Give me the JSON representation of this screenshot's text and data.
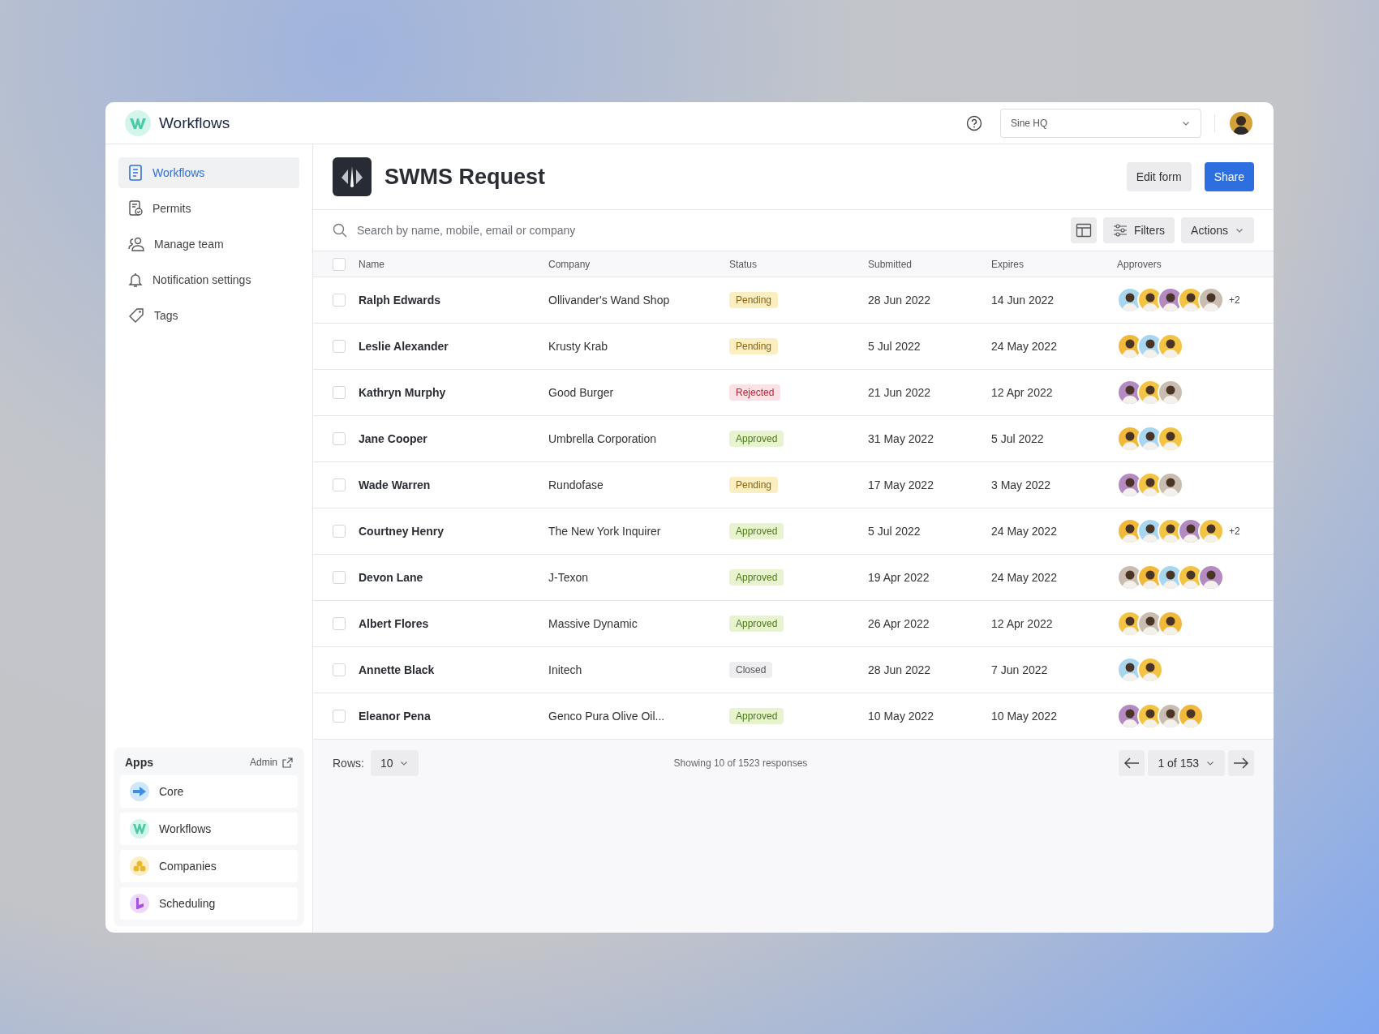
{
  "app": {
    "name": "Workflows"
  },
  "topbar": {
    "workspace": "Sine HQ"
  },
  "sidebar": {
    "items": [
      {
        "label": "Workflows",
        "selected": true
      },
      {
        "label": "Permits",
        "selected": false
      },
      {
        "label": "Manage team",
        "selected": false
      },
      {
        "label": "Notification settings",
        "selected": false
      },
      {
        "label": "Tags",
        "selected": false
      }
    ],
    "apps": {
      "title": "Apps",
      "admin": "Admin",
      "items": [
        {
          "label": "Core",
          "color": "#cfe6fb"
        },
        {
          "label": "Workflows",
          "color": "#d3f5ec"
        },
        {
          "label": "Companies",
          "color": "#fcefc7"
        },
        {
          "label": "Scheduling",
          "color": "#eed9fb"
        }
      ]
    }
  },
  "header": {
    "title": "SWMS Request",
    "buttons": [
      {
        "label": "Edit form",
        "kind": "secondary"
      },
      {
        "label": "Share",
        "kind": "primary"
      }
    ]
  },
  "toolbar": {
    "search_placeholder": "Search by name, mobile, email or company",
    "filters": "Filters",
    "actions": "Actions"
  },
  "table": {
    "select_all_checked": false,
    "columns": [
      "Name",
      "Company",
      "Status",
      "Submitted",
      "Expires",
      "Approvers"
    ],
    "rows": [
      {
        "name": "Ralph Edwards",
        "company": "Ollivander's Wand Shop",
        "status": {
          "label": "Pending",
          "kind": "pending"
        },
        "submitted": "28 Jun 2022",
        "expires": "14 Jun 2022",
        "approvers": [
          {
            "color": "#a9d6ef"
          },
          {
            "color": "#f3c443"
          },
          {
            "color": "#b48ac2"
          },
          {
            "color": "#f3c443"
          },
          {
            "color": "#c9bdb2"
          }
        ],
        "more": "+2",
        "checked": false
      },
      {
        "name": "Leslie Alexander",
        "company": "Krusty Krab",
        "status": {
          "label": "Pending",
          "kind": "pending"
        },
        "submitted": "5 Jul 2022",
        "expires": "24 May 2022",
        "approvers": [
          {
            "color": "#f0b93a"
          },
          {
            "color": "#a9d6ef"
          },
          {
            "color": "#f3c443"
          }
        ],
        "checked": false
      },
      {
        "name": "Kathryn Murphy",
        "company": "Good Burger",
        "status": {
          "label": "Rejected",
          "kind": "rejected"
        },
        "submitted": "21 Jun 2022",
        "expires": "12 Apr 2022",
        "approvers": [
          {
            "color": "#b48ac2"
          },
          {
            "color": "#f3c443"
          },
          {
            "color": "#c9bdb2"
          }
        ],
        "checked": false
      },
      {
        "name": "Jane Cooper",
        "company": "Umbrella Corporation",
        "status": {
          "label": "Approved",
          "kind": "approved"
        },
        "submitted": "31 May 2022",
        "expires": "5 Jul 2022",
        "approvers": [
          {
            "color": "#f0b93a"
          },
          {
            "color": "#a9d6ef"
          },
          {
            "color": "#f3c443"
          }
        ],
        "checked": false
      },
      {
        "name": "Wade Warren",
        "company": "Rundofase",
        "status": {
          "label": "Pending",
          "kind": "pending"
        },
        "submitted": "17 May 2022",
        "expires": "3 May 2022",
        "approvers": [
          {
            "color": "#b48ac2"
          },
          {
            "color": "#f3c443"
          },
          {
            "color": "#c9bdb2"
          }
        ],
        "checked": false
      },
      {
        "name": "Courtney Henry",
        "company": "The New York Inquirer",
        "status": {
          "label": "Approved",
          "kind": "approved"
        },
        "submitted": "5 Jul 2022",
        "expires": "24 May 2022",
        "approvers": [
          {
            "color": "#f0b93a"
          },
          {
            "color": "#a9d6ef"
          },
          {
            "color": "#f3c443"
          },
          {
            "color": "#b48ac2"
          },
          {
            "color": "#f3c443"
          }
        ],
        "more": "+2",
        "checked": false
      },
      {
        "name": "Devon Lane",
        "company": "J-Texon",
        "status": {
          "label": "Approved",
          "kind": "approved"
        },
        "submitted": "19 Apr 2022",
        "expires": "24 May 2022",
        "approvers": [
          {
            "color": "#c9bdb2"
          },
          {
            "color": "#f0b93a"
          },
          {
            "color": "#a9d6ef"
          },
          {
            "color": "#f3c443"
          },
          {
            "color": "#b48ac2"
          }
        ],
        "checked": false
      },
      {
        "name": "Albert Flores",
        "company": "Massive Dynamic",
        "status": {
          "label": "Approved",
          "kind": "approved"
        },
        "submitted": "26 Apr 2022",
        "expires": "12 Apr 2022",
        "approvers": [
          {
            "color": "#f3c443"
          },
          {
            "color": "#c9bdb2"
          },
          {
            "color": "#f0b93a"
          }
        ],
        "checked": false
      },
      {
        "name": "Annette Black",
        "company": "Initech",
        "status": {
          "label": "Closed",
          "kind": "closed"
        },
        "submitted": "28 Jun 2022",
        "expires": "7 Jun 2022",
        "approvers": [
          {
            "color": "#a9d6ef"
          },
          {
            "color": "#f3c443"
          }
        ],
        "checked": false
      },
      {
        "name": "Eleanor Pena",
        "company": "Genco Pura Olive Oil...",
        "status": {
          "label": "Approved",
          "kind": "approved"
        },
        "submitted": "10 May 2022",
        "expires": "10 May 2022",
        "approvers": [
          {
            "color": "#b48ac2"
          },
          {
            "color": "#f3c443"
          },
          {
            "color": "#c9bdb2"
          },
          {
            "color": "#f0b93a"
          }
        ],
        "checked": false
      }
    ]
  },
  "footer": {
    "rows_label": "Rows:",
    "rows_value": "10",
    "summary": "Showing 10 of 1523 responses",
    "page": "1 of 153"
  }
}
